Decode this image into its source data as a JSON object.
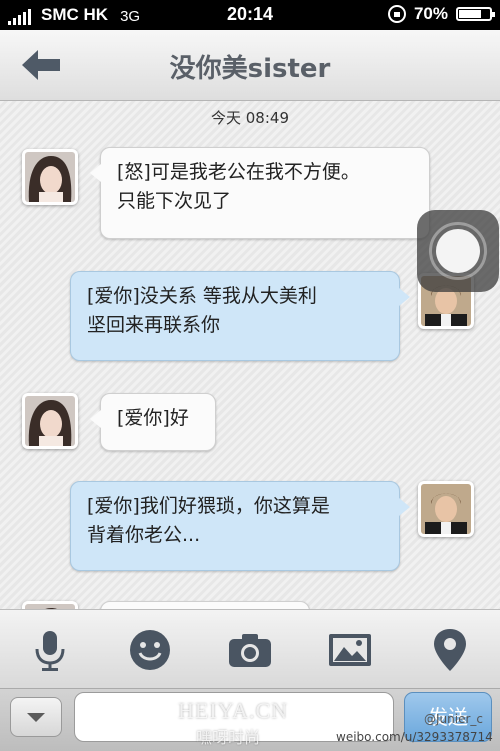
{
  "status_bar": {
    "carrier": "SMC HK",
    "network": "3G",
    "time": "20:14",
    "battery": "70%",
    "battery_level": 0.7
  },
  "header": {
    "title": "没你美sister"
  },
  "chat": {
    "timestamp": "今天 08:49",
    "messages": [
      {
        "side": "in",
        "lines": [
          "[怒]可是我老公在我不方便。",
          "只能下次见了"
        ]
      },
      {
        "side": "out",
        "lines": [
          "[爱你]没关系 等我从大美利",
          "坚回来再联系你"
        ]
      },
      {
        "side": "in",
        "lines": [
          "[爱你]好"
        ]
      },
      {
        "side": "out",
        "lines": [
          "[爱你]我们好猥琐，你这算是",
          "背着你老公..."
        ]
      }
    ]
  },
  "toolbar": {
    "icons": [
      "microphone-icon",
      "emoji-icon",
      "camera-icon",
      "image-icon",
      "location-icon"
    ]
  },
  "input_bar": {
    "input_value": "",
    "send_label": "发送"
  },
  "watermarks": {
    "site": "HEIYA.CN",
    "site_cn": "嘿呀时尚",
    "weibo_handle": "@Junier_c",
    "weibo_url": "weibo.com/u/3293378714"
  },
  "colors": {
    "bubble_out": "#cfe6f8",
    "bubble_in": "#fbfbfb",
    "title": "#5a6068"
  }
}
